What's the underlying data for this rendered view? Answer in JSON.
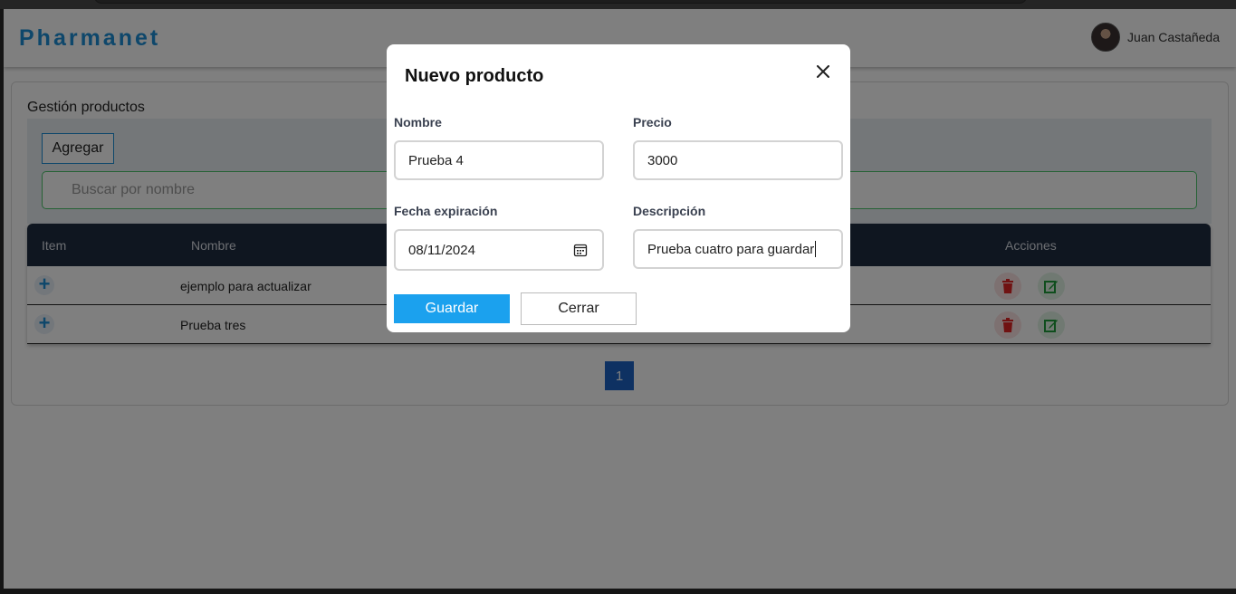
{
  "app": {
    "brand": "Pharmanet"
  },
  "user": {
    "name": "Juan Castañeda"
  },
  "page": {
    "title": "Gestión productos",
    "add_label": "Agregar",
    "search_placeholder": "Buscar por nombre"
  },
  "table": {
    "headers": {
      "item": "Item",
      "nombre": "Nombre",
      "acciones": "Acciones"
    },
    "rows": [
      {
        "nombre": "ejemplo para actualizar"
      },
      {
        "nombre": "Prueba tres"
      }
    ]
  },
  "pagination": {
    "current": "1"
  },
  "modal": {
    "title": "Nuevo producto",
    "fields": {
      "nombre": {
        "label": "Nombre",
        "value": "Prueba 4"
      },
      "precio": {
        "label": "Precio",
        "value": "3000"
      },
      "fecha": {
        "label": "Fecha expiración",
        "value": "08/11/2024"
      },
      "descripcion": {
        "label": "Descripción",
        "value": "Prueba cuatro para guardar"
      }
    },
    "save_label": "Guardar",
    "close_label": "Cerrar"
  },
  "colors": {
    "brand": "#1d8fd6",
    "table_header": "#1f2d40",
    "save_button": "#1ba1ee",
    "delete_icon": "#e02424",
    "edit_icon": "#1f9d3a",
    "search_border": "#4cc46a"
  },
  "icons": {
    "close": "close-icon",
    "calendar": "calendar-icon",
    "expand": "plus-icon",
    "delete": "trash-icon",
    "edit": "edit-icon"
  }
}
